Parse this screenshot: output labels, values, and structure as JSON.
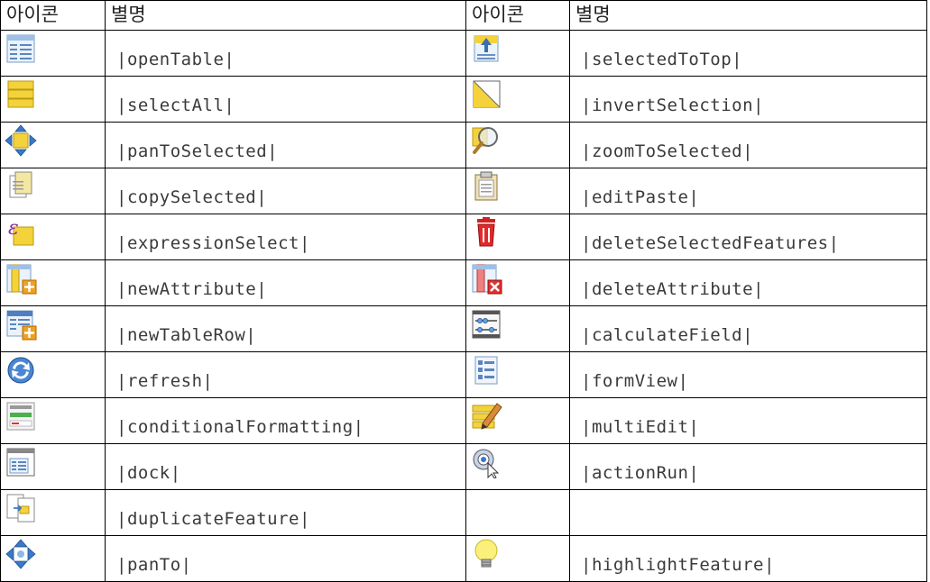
{
  "header": {
    "icon_col_left": "아이콘",
    "alias_col_left": "별명",
    "icon_col_right": "아이콘",
    "alias_col_right": "별명"
  },
  "rows": [
    {
      "left": {
        "icon": "open-table-icon",
        "alias": "|openTable|"
      },
      "right": {
        "icon": "selected-to-top-icon",
        "alias": "|selectedToTop|"
      }
    },
    {
      "left": {
        "icon": "select-all-icon",
        "alias": "|selectAll|"
      },
      "right": {
        "icon": "invert-selection-icon",
        "alias": "|invertSelection|"
      }
    },
    {
      "left": {
        "icon": "pan-to-selected-icon",
        "alias": "|panToSelected|"
      },
      "right": {
        "icon": "zoom-to-selected-icon",
        "alias": "|zoomToSelected|"
      }
    },
    {
      "left": {
        "icon": "copy-selected-icon",
        "alias": "|copySelected|"
      },
      "right": {
        "icon": "edit-paste-icon",
        "alias": "|editPaste|"
      }
    },
    {
      "left": {
        "icon": "expression-select-icon",
        "alias": "|expressionSelect|"
      },
      "right": {
        "icon": "delete-selected-features-icon",
        "alias": "|deleteSelectedFeatures|"
      }
    },
    {
      "left": {
        "icon": "new-attribute-icon",
        "alias": "|newAttribute|"
      },
      "right": {
        "icon": "delete-attribute-icon",
        "alias": "|deleteAttribute|"
      }
    },
    {
      "left": {
        "icon": "new-table-row-icon",
        "alias": "|newTableRow|"
      },
      "right": {
        "icon": "calculate-field-icon",
        "alias": "|calculateField|"
      }
    },
    {
      "left": {
        "icon": "refresh-icon",
        "alias": "|refresh|"
      },
      "right": {
        "icon": "form-view-icon",
        "alias": "|formView|"
      }
    },
    {
      "left": {
        "icon": "conditional-formatting-icon",
        "alias": "|conditionalFormatting|"
      },
      "right": {
        "icon": "multi-edit-icon",
        "alias": "|multiEdit|"
      }
    },
    {
      "left": {
        "icon": "dock-icon",
        "alias": "|dock|"
      },
      "right": {
        "icon": "action-run-icon",
        "alias": "|actionRun|"
      }
    },
    {
      "left": {
        "icon": "duplicate-feature-icon",
        "alias": "|duplicateFeature|"
      },
      "right": {
        "icon": "",
        "alias": ""
      }
    },
    {
      "left": {
        "icon": "pan-to-icon",
        "alias": "|panTo|"
      },
      "right": {
        "icon": "highlight-feature-icon",
        "alias": "|highlightFeature|"
      }
    }
  ]
}
